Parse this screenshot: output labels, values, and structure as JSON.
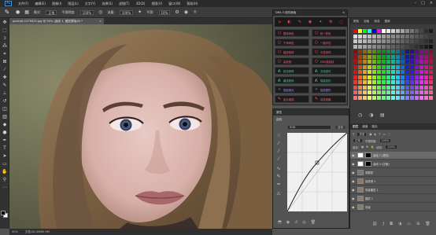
{
  "menu": {
    "logo": "Ps",
    "items": [
      "文件(F)",
      "编辑(E)",
      "图像(I)",
      "图层(L)",
      "文字(Y)",
      "选择(S)",
      "滤镜(T)",
      "3D(D)",
      "视图(V)",
      "窗口(W)",
      "帮助(H)"
    ]
  },
  "options": {
    "mode_label": "模式:",
    "mode_value": "正常",
    "opacity_label": "不透明度:",
    "opacity_value": "100%",
    "flow_label": "流量:",
    "flow_value": "100%",
    "smooth_label": "平滑:",
    "smooth_value": "10%"
  },
  "document": {
    "tab_label": "portrait-1579025.jpg @ 50% (曲线 1, 图层蒙版/8) *",
    "zoom": "50%",
    "doc_info": "文档:26.4M/85.9M"
  },
  "swatches": {
    "tabs": [
      "颜色",
      "色板",
      "渐变",
      "图案"
    ],
    "accent_colors": [
      "#ff0000",
      "#ffff00",
      "#00ff00",
      "#00ffff",
      "#0000ff",
      "#ff00ff"
    ]
  },
  "dr4": {
    "title": "DR4.5 插件面板",
    "buttons": [
      {
        "label": "整体润色",
        "color": "#ff5a6a"
      },
      {
        "label": "统一肤色",
        "color": "#ff5a6a"
      },
      {
        "label": "干净润色",
        "color": "#ff5a6a"
      },
      {
        "label": "一键中性",
        "color": "#ff5a6a"
      },
      {
        "label": "磨皮精修",
        "color": "#ff5a6a"
      },
      {
        "label": "中性修饰",
        "color": "#ff5a6a"
      },
      {
        "label": "高低频",
        "color": "#ff5a6a"
      },
      {
        "label": "DR4双曲线",
        "color": "#ff5a6a"
      },
      {
        "label": "锐化精修",
        "color": "#3ec98e"
      },
      {
        "label": "去色锐化",
        "color": "#3ec98e"
      },
      {
        "label": "磨皮精修",
        "color": "#3ec98e"
      },
      {
        "label": "智能锐化",
        "color": "#3ec98e"
      },
      {
        "label": "智能美化",
        "color": "#9a8cff"
      },
      {
        "label": "智能塑形",
        "color": "#9a8cff"
      },
      {
        "label": "高光增强",
        "color": "#ff5a6a"
      },
      {
        "label": "高低频磨",
        "color": "#ff5a6a"
      }
    ]
  },
  "properties": {
    "tab_label": "属性",
    "title": "曲线",
    "preset": "RGB",
    "auto_label": "自动"
  },
  "layers": {
    "tabs": [
      "图层",
      "通道",
      "路径"
    ],
    "active_tab": "图层",
    "kind_label": "类型",
    "blend_mode": "正常",
    "opacity_label": "不透明度:",
    "opacity_value": "100%",
    "lock_label": "锁定:",
    "fill_label": "填充:",
    "fill_value": "100%",
    "items": [
      {
        "name": "曲线 1 (提亮)",
        "thumb": "#ffffff"
      },
      {
        "name": "曲线 2 (压暗)",
        "thumb": "#ffffff"
      },
      {
        "name": "观察层",
        "thumb": "#777777"
      },
      {
        "name": "高低频 2",
        "thumb": "#8a7a6a"
      },
      {
        "name": "背景图层 1",
        "thumb": "#8a7a6a"
      },
      {
        "name": "图层 1",
        "thumb": "#8a7a6a"
      },
      {
        "name": "背景",
        "thumb": "#8a7a6a"
      }
    ]
  }
}
